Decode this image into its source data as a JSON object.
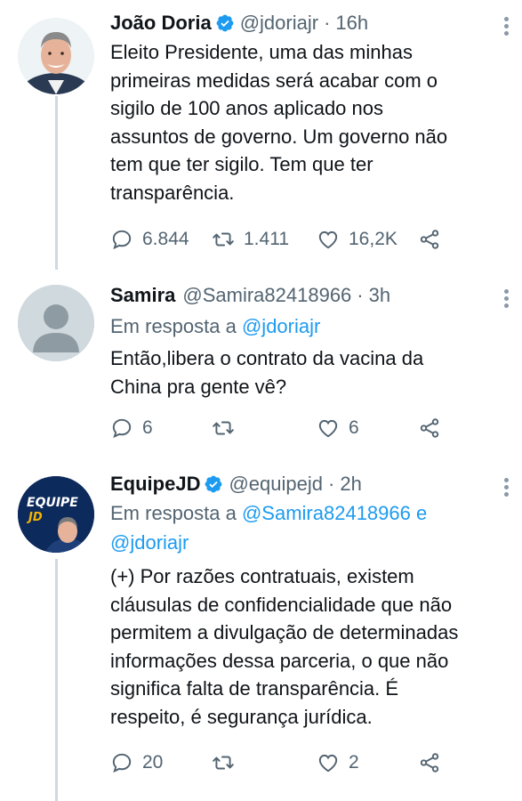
{
  "tweets": [
    {
      "name": "João Doria",
      "verified": true,
      "handle": "@jdoriajr",
      "time": "16h",
      "reply_to_prefix": "",
      "reply_to": [],
      "text_lines": [
        "Eleito Presidente, uma das minhas",
        "primeiras medidas será acabar com o",
        "sigilo de 100 anos aplicado nos",
        "assuntos de governo. Um governo não",
        "tem que ter sigilo. Tem que ter",
        "transparência."
      ],
      "replies": "6.844",
      "retweets": "1.411",
      "likes": "16,2K"
    },
    {
      "name": "Samira",
      "verified": false,
      "handle": "@Samira82418966",
      "time": "3h",
      "reply_to_prefix": "Em resposta a",
      "reply_to": [
        "@jdoriajr"
      ],
      "text_lines": [
        "Então,libera o contrato da vacina da",
        "China pra gente vê?"
      ],
      "replies": "6",
      "retweets": "",
      "likes": "6"
    },
    {
      "name": "EquipeJD",
      "verified": true,
      "handle": "@equipejd",
      "time": "2h",
      "reply_to_prefix": "Em resposta a",
      "reply_to": [
        "@Samira82418966",
        "e",
        "@jdoriajr"
      ],
      "avatar_text": [
        "EQUIPE",
        "JD"
      ],
      "text_lines": [
        "(+) Por razões contratuais, existem",
        "cláusulas de confidencialidade que não",
        "permitem a divulgação de determinadas",
        "informações dessa parceria, o que não",
        "significa falta de transparência. É",
        "respeito, é segurança jurídica."
      ],
      "replies": "20",
      "retweets": "",
      "likes": "2"
    }
  ],
  "separator_dot": "·",
  "colors": {
    "accent": "#1d9bf0",
    "secondary_text": "#536471",
    "primary_text": "#0f1419",
    "thread_line": "#cfd9de"
  },
  "icons": [
    "verified-badge-icon",
    "more-icon",
    "reply-icon",
    "retweet-icon",
    "like-icon",
    "share-icon"
  ]
}
